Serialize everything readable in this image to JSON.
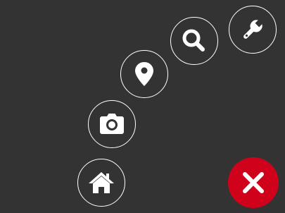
{
  "radial_menu": {
    "items": [
      {
        "id": "tools",
        "icon": "wrench-icon"
      },
      {
        "id": "search",
        "icon": "search-icon"
      },
      {
        "id": "location",
        "icon": "map-pin-icon"
      },
      {
        "id": "camera",
        "icon": "camera-icon"
      },
      {
        "id": "home",
        "icon": "home-icon"
      }
    ],
    "close_button": {
      "icon": "close-icon",
      "color": "#d0021b"
    },
    "ring_color": "#ffffff",
    "background": "#333333"
  }
}
